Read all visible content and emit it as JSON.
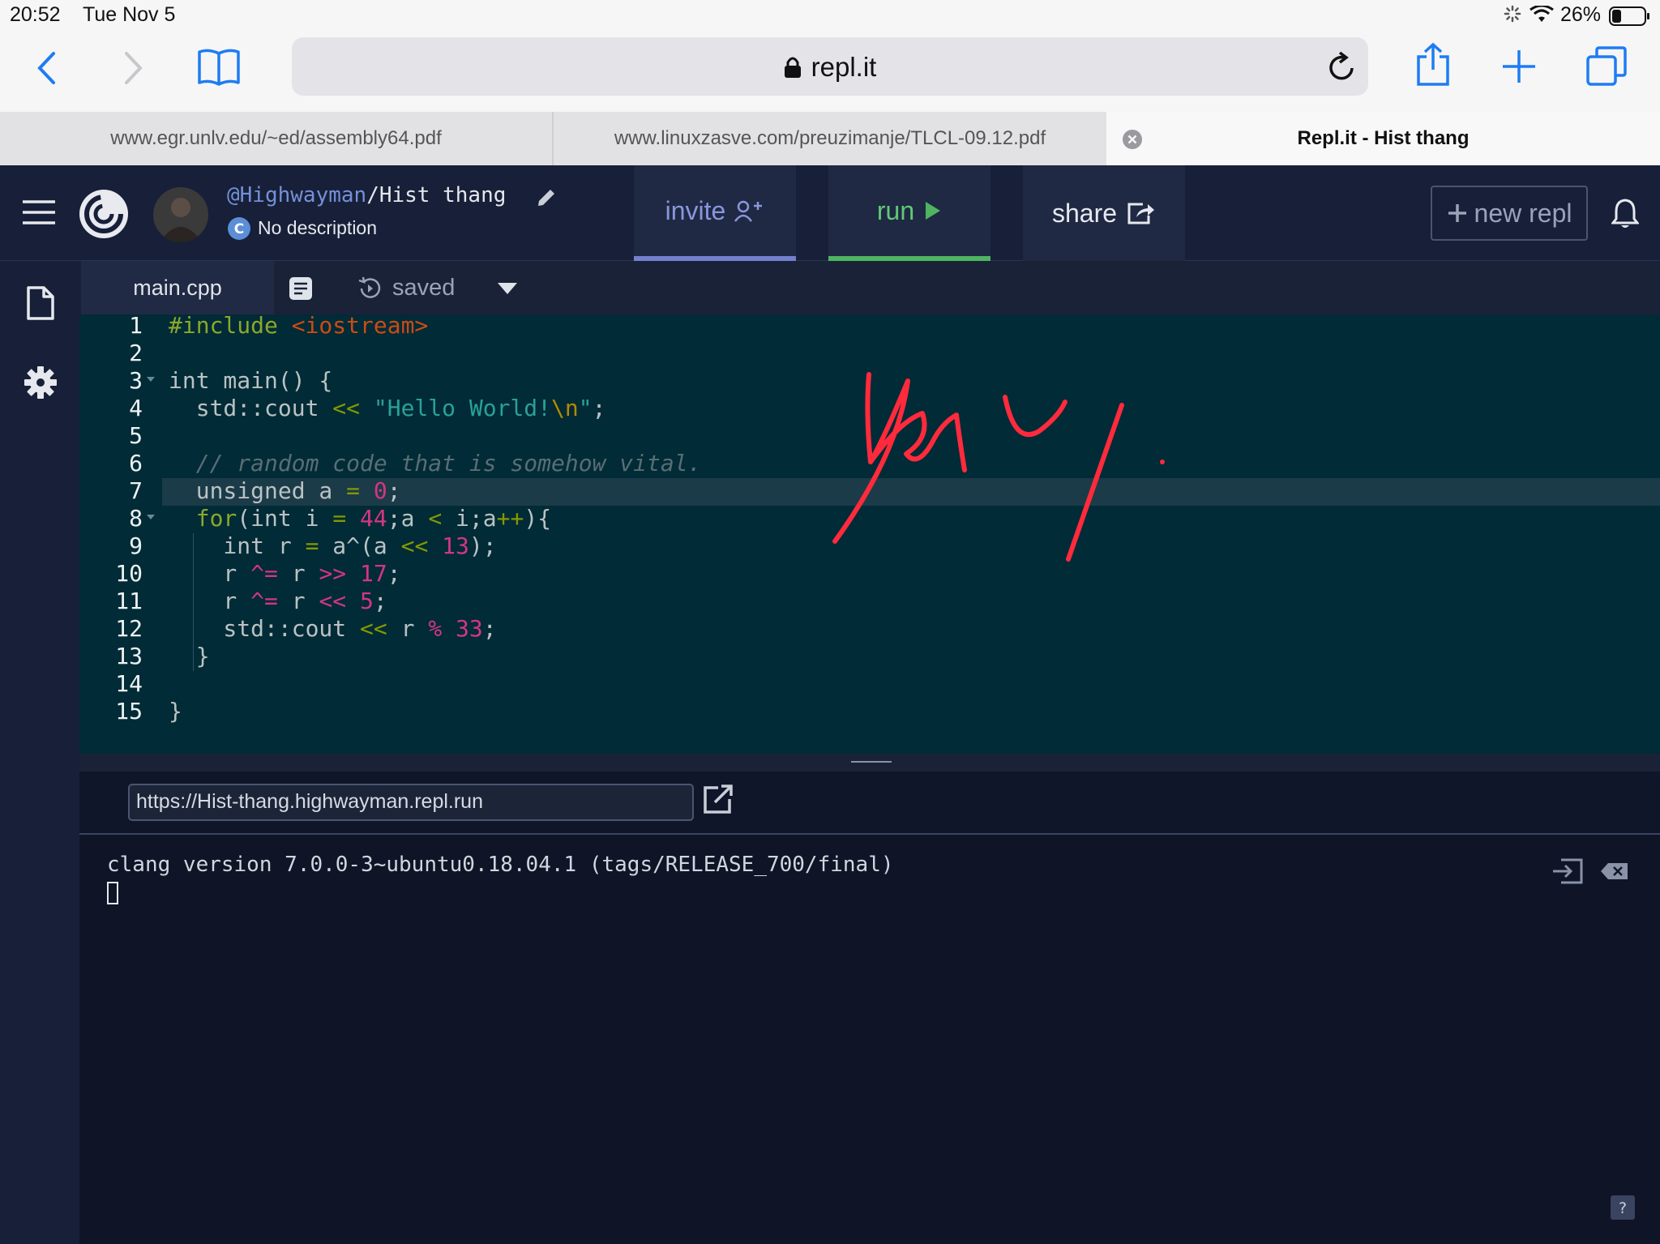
{
  "status_bar": {
    "time": "20:52",
    "date": "Tue Nov 5",
    "battery": "26%"
  },
  "safari": {
    "url": "repl.it",
    "tabs": [
      {
        "title": "www.egr.unlv.edu/~ed/assembly64.pdf"
      },
      {
        "title": "www.linuxzasve.com/preuzimanje/TLCL-09.12.pdf"
      },
      {
        "title": "Repl.it - Hist thang"
      }
    ]
  },
  "repl": {
    "user": "@Highwayman",
    "slash": "/",
    "name": "Hist thang",
    "description": "No description",
    "buttons": {
      "invite": "invite",
      "run": "run",
      "share": "share",
      "new_repl": "new repl"
    },
    "file": {
      "name": "main.cpp",
      "status": "saved"
    },
    "line_numbers": [
      "1",
      "2",
      "3",
      "4",
      "5",
      "6",
      "7",
      "8",
      "9",
      "10",
      "11",
      "12",
      "13",
      "14",
      "15"
    ],
    "code": {
      "l1a": "#include ",
      "l1b": "<iostream>",
      "l3": "int main() {",
      "l4a": "  std::cout ",
      "l4b": "<<",
      "l4c": " \"Hello World!",
      "l4d": "\\n",
      "l4e": "\"",
      "l4f": ";",
      "l6": "  // random code that is somehow vital.",
      "l7a": "  unsigned a ",
      "l7b": "=",
      "l7c": " 0",
      "l7d": ";",
      "l8a": "  for",
      "l8b": "(int i ",
      "l8c": "=",
      "l8d": " 44",
      "l8e": ";a ",
      "l8f": "<",
      "l8g": " i;a",
      "l8h": "++",
      "l8i": "){",
      "l9a": "    int r ",
      "l9b": "=",
      "l9c": " a^(a ",
      "l9d": "<<",
      "l9e": " 13",
      "l9f": ");",
      "l10a": "    r ",
      "l10b": "^=",
      "l10c": " r ",
      "l10d": ">>",
      "l10e": " 17",
      "l10f": ";",
      "l11a": "    r ",
      "l11b": "^=",
      "l11c": " r ",
      "l11d": "<<",
      "l11e": " 5",
      "l11f": ";",
      "l12a": "    std::cout ",
      "l12b": "<<",
      "l12c": " r ",
      "l12d": "%",
      "l12e": " 33",
      "l12f": ";",
      "l13": "  }",
      "l15": "}"
    },
    "web_url": "https://Hist-thang.highwayman.repl.run",
    "console_output": "clang version 7.0.0-3~ubuntu0.18.04.1 (tags/RELEASE_700/final)"
  },
  "handwriting": "Yay.",
  "colors": {
    "run_accent": "#4fb462",
    "invite_accent": "#7480cc",
    "handwriting": "#ff2a3c"
  }
}
